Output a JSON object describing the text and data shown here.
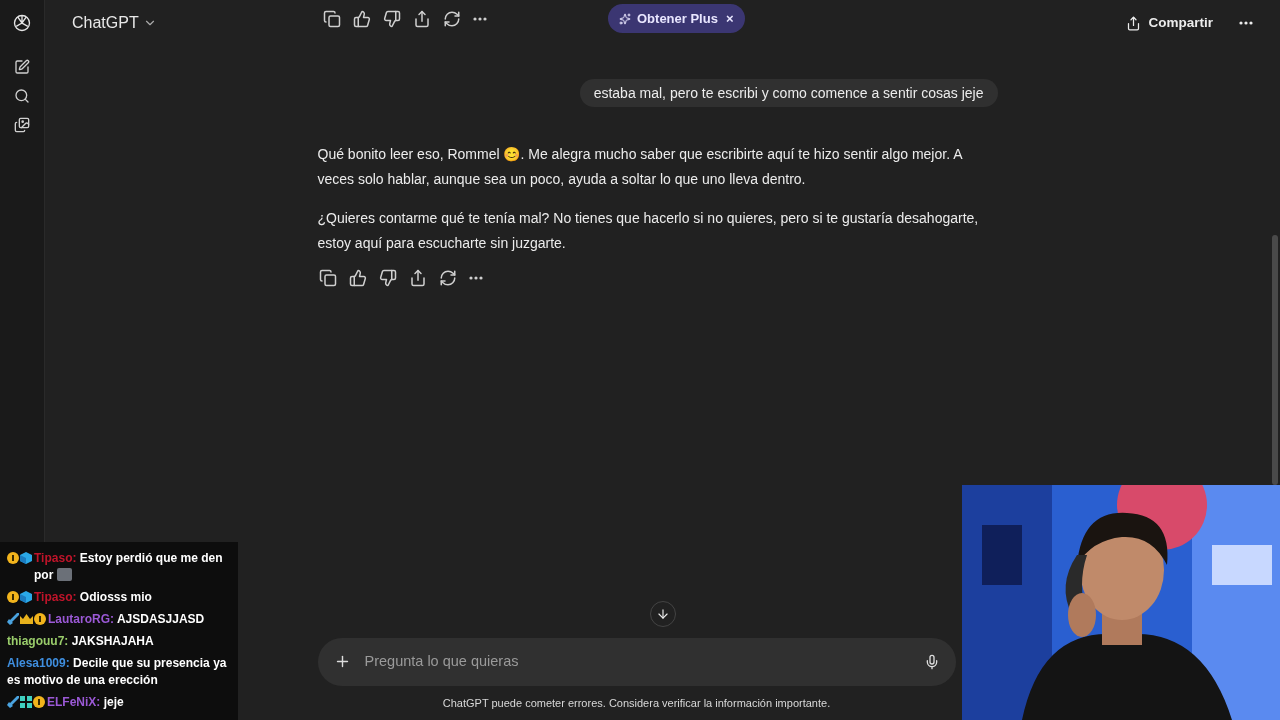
{
  "header": {
    "title": "ChatGPT",
    "promo": "Obtener Plus",
    "promo_close": "×",
    "share": "Compartir"
  },
  "user_message": "estaba mal, pero te escribi y como comence a sentir cosas jeje",
  "reply": [
    "Qué bonito leer eso, Rommel 😊. Me alegra mucho saber que escribirte aquí te hizo sentir algo mejor. A veces solo hablar, aunque sea un poco, ayuda a soltar lo que uno lleva dentro.",
    "¿Quieres contarme qué te tenía mal? No tienes que hacerlo si no quieres, pero si te gustaría desahogarte, estoy aquí para escucharte sin juzgarte."
  ],
  "composer": {
    "placeholder": "Pregunta lo que quieras"
  },
  "disclaimer": "ChatGPT puede cometer errores. Considera verificar la información importante.",
  "stream_chat": [
    {
      "badges": [
        {
          "kind": "coin"
        },
        {
          "kind": "cube"
        }
      ],
      "user": "Tipaso:",
      "color": "#c0142a",
      "text": "Estoy perdió que me den por",
      "emote": true
    },
    {
      "badges": [
        {
          "kind": "coin"
        },
        {
          "kind": "cube"
        }
      ],
      "user": "Tipaso:",
      "color": "#c0142a",
      "text": "Odiosss mio"
    },
    {
      "badges": [
        {
          "kind": "sword"
        },
        {
          "kind": "crown"
        },
        {
          "kind": "coin"
        }
      ],
      "user": "LautaroRG:",
      "color": "#9b59d6",
      "text": "AJSDASJJASD"
    },
    {
      "user": "thiagouu7:",
      "color": "#9acd6b",
      "text": "JAKSHAJAHA"
    },
    {
      "user": "Alesa1009:",
      "color": "#3f8fe0",
      "text": "Decile que su presencia ya es motivo de una erección"
    },
    {
      "badges": [
        {
          "kind": "sword"
        },
        {
          "kind": "grid"
        },
        {
          "kind": "coin"
        }
      ],
      "user": "ELFeNiX:",
      "color": "#9b59d6",
      "text": "jeje"
    }
  ],
  "webcam": {
    "kind": "picture"
  }
}
